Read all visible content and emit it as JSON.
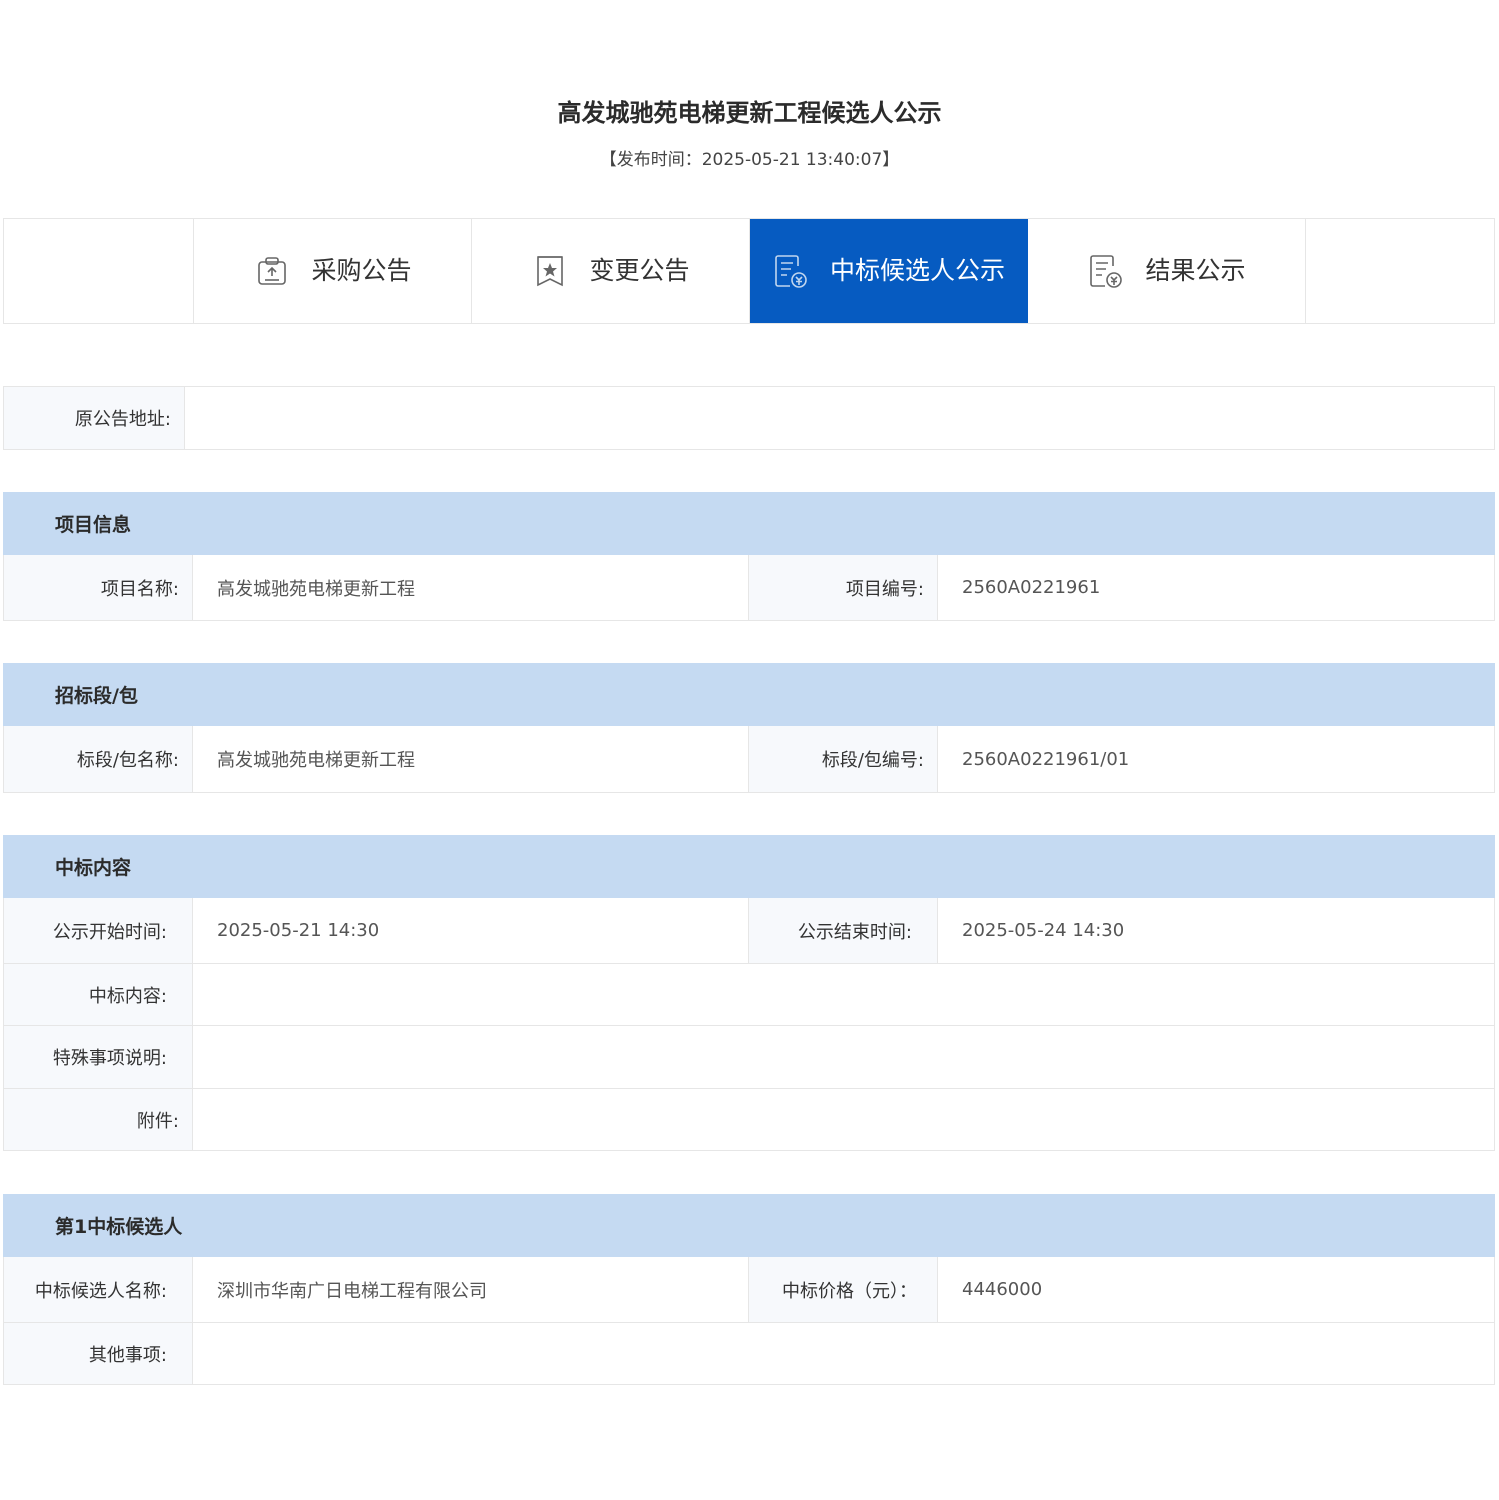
{
  "page": {
    "title": "高发城驰苑电梯更新工程候选人公示",
    "publish_time": "【发布时间：2025-05-21 13:40:07】"
  },
  "tabs": [
    {
      "label": "采购公告",
      "icon": "procurement-icon",
      "active": false
    },
    {
      "label": "变更公告",
      "icon": "change-notice-icon",
      "active": false
    },
    {
      "label": "中标候选人公示",
      "icon": "candidate-notice-icon",
      "active": true
    },
    {
      "label": "结果公示",
      "icon": "result-notice-icon",
      "active": false
    }
  ],
  "original": {
    "label": "原公告地址:",
    "value": ""
  },
  "project_info": {
    "header": "项目信息",
    "name_label": "项目名称:",
    "name_value": "高发城驰苑电梯更新工程",
    "code_label": "项目编号:",
    "code_value": "2560A0221961"
  },
  "section_pkg": {
    "header": "招标段/包",
    "name_label": "标段/包名称:",
    "name_value": "高发城驰苑电梯更新工程",
    "code_label": "标段/包编号:",
    "code_value": "2560A0221961/01"
  },
  "award": {
    "header": "中标内容",
    "start_label": "公示开始时间:",
    "start_value": "2025-05-21 14:30",
    "end_label": "公示结束时间:",
    "end_value": "2025-05-24 14:30",
    "content_label": "中标内容:",
    "content_value": "",
    "special_label": "特殊事项说明:",
    "special_value": "",
    "attachment_label": "附件:",
    "attachment_value": ""
  },
  "candidate1": {
    "header": "第1中标候选人",
    "name_label": "中标候选人名称:",
    "name_value": "深圳市华南广日电梯工程有限公司",
    "price_label": "中标价格（元）：",
    "price_value": "4446000",
    "other_label": "其他事项:",
    "other_value": ""
  },
  "colors": {
    "accent": "#065bc1",
    "section_header_bg": "#c5daf2",
    "label_bg": "#f7f9fc",
    "border": "#e6e6e6"
  }
}
